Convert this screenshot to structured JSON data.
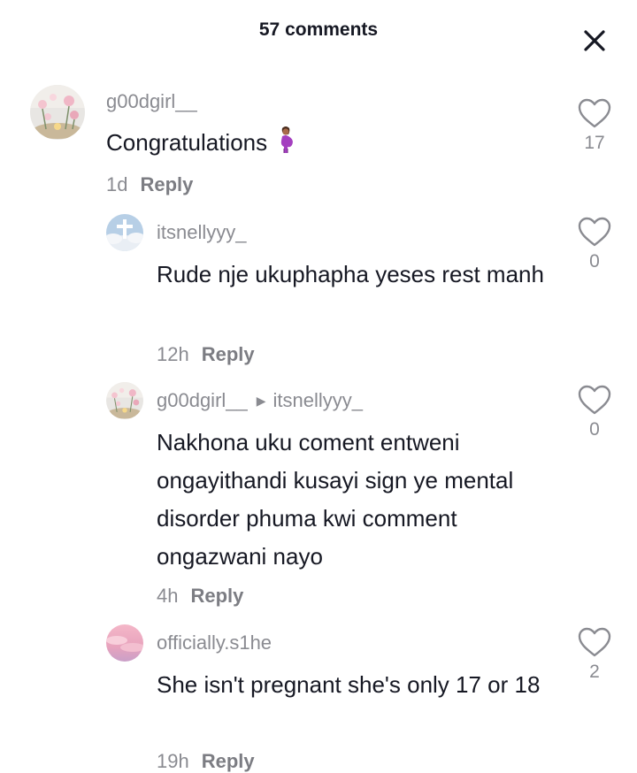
{
  "header": {
    "title": "57 comments",
    "close_icon": "close-icon"
  },
  "comments": [
    {
      "username": "g00dgirl__",
      "text": "Congratulations",
      "emoji": "pregnant-woman-emoji",
      "time": "1d",
      "reply_label": "Reply",
      "likes": "17",
      "avatar": "flowers-avatar"
    },
    {
      "username": "itsnellyyy_",
      "text": "Rude nje ukuphapha yeses rest manh",
      "time": "12h",
      "reply_label": "Reply",
      "likes": "0",
      "avatar": "sky-cross-avatar"
    },
    {
      "username": "g00dgirl__",
      "reply_to": "itsnellyyy_",
      "text": "Nakhona uku coment entweni ongayithandi kusayi sign ye mental disorder phuma kwi comment ongazwani nayo",
      "time": "4h",
      "reply_label": "Reply",
      "likes": "0",
      "avatar": "flowers-avatar"
    },
    {
      "username": "officially.s1he",
      "text": "She isn't pregnant she's only 17 or 18",
      "time": "19h",
      "reply_label": "Reply",
      "likes": "2",
      "avatar": "pink-sky-avatar"
    }
  ],
  "colors": {
    "primary_text": "#161823",
    "secondary_text": "#8a8b91",
    "background": "#ffffff"
  }
}
